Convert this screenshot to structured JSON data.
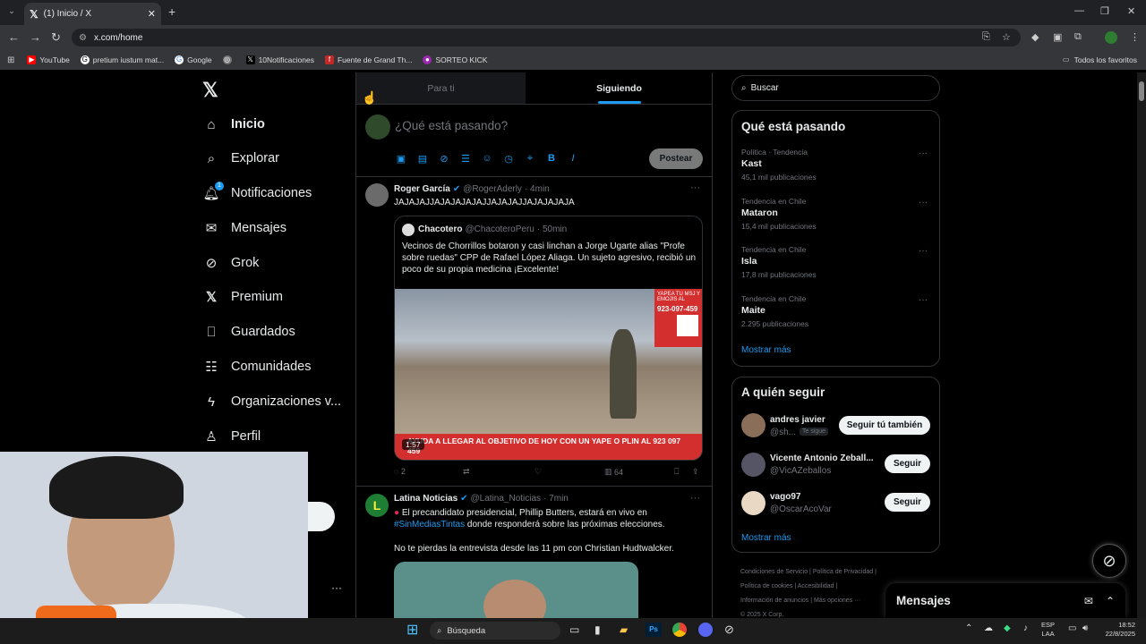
{
  "browser": {
    "tab_title": "(1) Inicio / X",
    "url": "x.com/home",
    "bookmarks": [
      "YouTube",
      "pretium iustum mat...",
      "Google",
      "",
      "10Notificaciones",
      "Fuente de Grand Th...",
      "SORTEO KICK"
    ],
    "all_bookmarks": "Todos los favoritos"
  },
  "nav": {
    "items": [
      "Inicio",
      "Explorar",
      "Notificaciones",
      "Mensajes",
      "Grok",
      "Premium",
      "Guardados",
      "Comunidades",
      "Organizaciones v...",
      "Perfil"
    ],
    "notif_badge": "1"
  },
  "feed": {
    "tabs": [
      "Para ti",
      "Siguiendo"
    ],
    "composer_placeholder": "¿Qué está pasando?",
    "post_button": "Postear",
    "tweets": [
      {
        "name": "Roger García",
        "handle": "@RogerAderly",
        "time": "· 4min",
        "text": "JAJAJAJJAJAJAJAJAJJAJAJAJJAJAJAJAJA",
        "quote": {
          "name": "Chacotero",
          "handle": "@ChacoteroPeru",
          "time": "· 50min",
          "text": "Vecinos de Chorrillos botaron y casi linchan a Jorge Ugarte alias \"Profe sobre ruedas\" CPP de Rafael López Aliaga. Un sujeto agresivo, recibió un poco de su propia medicina ¡Excelente!",
          "video_banner": "AYUDA A LLEGAR AL OBJETIVO DE HOY CON UN YAPE O PLIN AL 923 097 459",
          "video_top": "YAPEA TU MSJ Y EMOJIS AL",
          "video_phone": "923-097-459",
          "duration": "1:57"
        },
        "replies": "2",
        "views": "64"
      },
      {
        "name": "Latina Noticias",
        "handle": "@Latina_Noticias",
        "time": "· 7min",
        "line1": "El precandidato presidencial, Phillip Butters, estará en vivo en",
        "hashtag": "#SinMediasTintas",
        "line2": " donde responderá sobre las próximas elecciones.",
        "line3": "No te pierdas la entrevista desde las 11 pm con Christian Hudtwalcker."
      }
    ]
  },
  "right": {
    "search_placeholder": "Buscar",
    "trends_title": "Qué está pasando",
    "trends": [
      {
        "cat": "Política · Tendencia",
        "name": "Kast",
        "count": "45,1 mil publicaciones"
      },
      {
        "cat": "Tendencia en Chile",
        "name": "Mataron",
        "count": "15,4 mil publicaciones"
      },
      {
        "cat": "Tendencia en Chile",
        "name": "Isla",
        "count": "17,8 mil publicaciones"
      },
      {
        "cat": "Tendencia en Chile",
        "name": "Maite",
        "count": "2.295 publicaciones"
      }
    ],
    "show_more": "Mostrar más",
    "follow_title": "A quién seguir",
    "follow": [
      {
        "name": "andres javier",
        "handle": "@sh...",
        "badge": "Te sigue",
        "button": "Seguir tú también"
      },
      {
        "name": "Vicente Antonio Zeball...",
        "handle": "@VicAZeballos",
        "button": "Seguir"
      },
      {
        "name": "vago97",
        "handle": "@OscarAcoVar",
        "button": "Seguir"
      }
    ],
    "show_more2": "Mostrar más",
    "footer": [
      "Condiciones de Servicio",
      "Política de Privacidad",
      "Política de cookies",
      "Accesibilidad",
      "Información de anuncios",
      "Más opciones ···",
      "© 2025 X Corp."
    ],
    "messages": "Mensajes"
  },
  "taskbar": {
    "search": "Búsqueda",
    "lang1": "ESP",
    "lang2": "LAA",
    "time": "18:52",
    "date": "22/8/2025"
  },
  "colors": {
    "accent": "#1d9bf0",
    "bg": "#000000",
    "border": "#2f3336",
    "muted": "#71767b"
  }
}
